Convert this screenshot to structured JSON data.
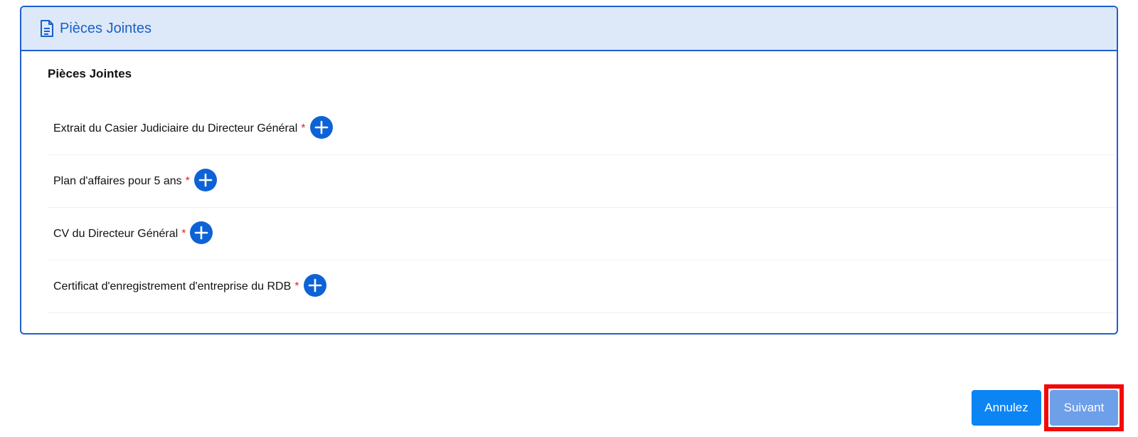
{
  "panel": {
    "header_title": "Pièces Jointes",
    "header_icon": "document-icon",
    "section_title": "Pièces Jointes",
    "required_marker": "*",
    "add_icon": "plus-circle-icon",
    "items": [
      {
        "label": "Extrait du Casier Judiciaire du Directeur Général"
      },
      {
        "label": "Plan d'affaires pour 5 ans"
      },
      {
        "label": "CV du Directeur Général"
      },
      {
        "label": "Certificat d'enregistrement d'entreprise du RDB"
      }
    ]
  },
  "actions": {
    "cancel_label": "Annulez",
    "next_label": "Suivant"
  },
  "colors": {
    "accent": "#0d63d6",
    "header_bg": "#dde9f9",
    "required": "#e8202e",
    "highlight_border": "#f20a0a"
  }
}
